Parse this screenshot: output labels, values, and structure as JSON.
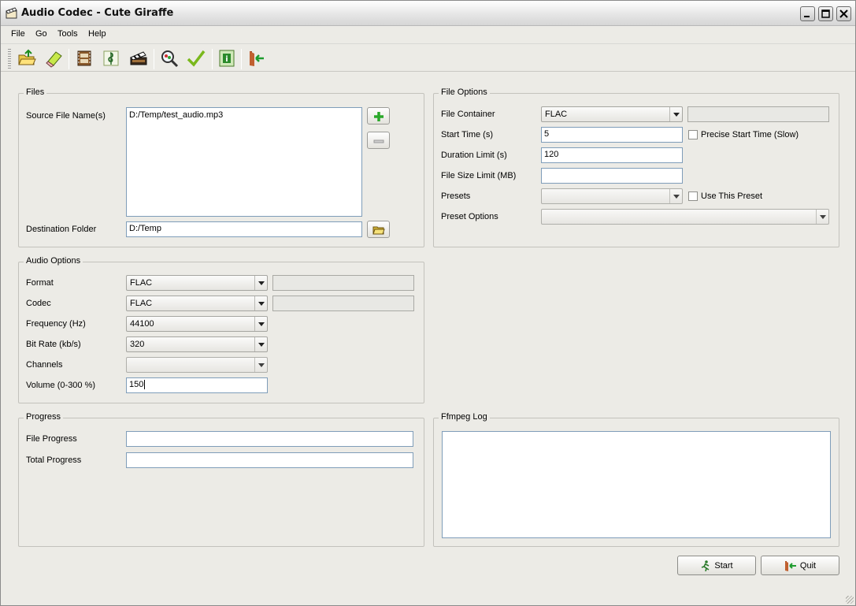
{
  "window": {
    "title": "Audio Codec - Cute Giraffe"
  },
  "menu": [
    "File",
    "Go",
    "Tools",
    "Help"
  ],
  "toolbar": {
    "icons": [
      "open-folder-icon",
      "eraser-icon",
      "film-icon",
      "music-icon",
      "clapperboard-icon",
      "search-icon",
      "checkmark-icon",
      "info-icon",
      "quit-arrow-icon"
    ]
  },
  "files": {
    "title": "Files",
    "source_label": "Source File Name(s)",
    "source_items": [
      "D:/Temp/test_audio.mp3"
    ],
    "destination_label": "Destination Folder",
    "destination_value": "D:/Temp"
  },
  "file_options": {
    "title": "File Options",
    "container_label": "File Container",
    "container_value": "FLAC",
    "container_extra": "",
    "start_time_label": "Start Time (s)",
    "start_time_value": "5",
    "precise_label": "Precise Start Time (Slow)",
    "duration_label": "Duration Limit (s)",
    "duration_value": "120",
    "size_label": "File Size Limit (MB)",
    "size_value": "",
    "presets_label": "Presets",
    "presets_value": "",
    "use_preset_label": "Use This Preset",
    "preset_options_label": "Preset Options",
    "preset_options_value": ""
  },
  "audio_options": {
    "title": "Audio Options",
    "format_label": "Format",
    "format_value": "FLAC",
    "codec_label": "Codec",
    "codec_value": "FLAC",
    "frequency_label": "Frequency (Hz)",
    "frequency_value": "44100",
    "bitrate_label": "Bit Rate (kb/s)",
    "bitrate_value": "320",
    "channels_label": "Channels",
    "channels_value": "",
    "volume_label": "Volume (0-300 %)",
    "volume_value": "150"
  },
  "progress": {
    "title": "Progress",
    "file_label": "File Progress",
    "total_label": "Total Progress",
    "file_percent": 0,
    "total_percent": 0
  },
  "log": {
    "title": "Ffmpeg Log",
    "content": ""
  },
  "buttons": {
    "start": "Start",
    "quit": "Quit"
  }
}
